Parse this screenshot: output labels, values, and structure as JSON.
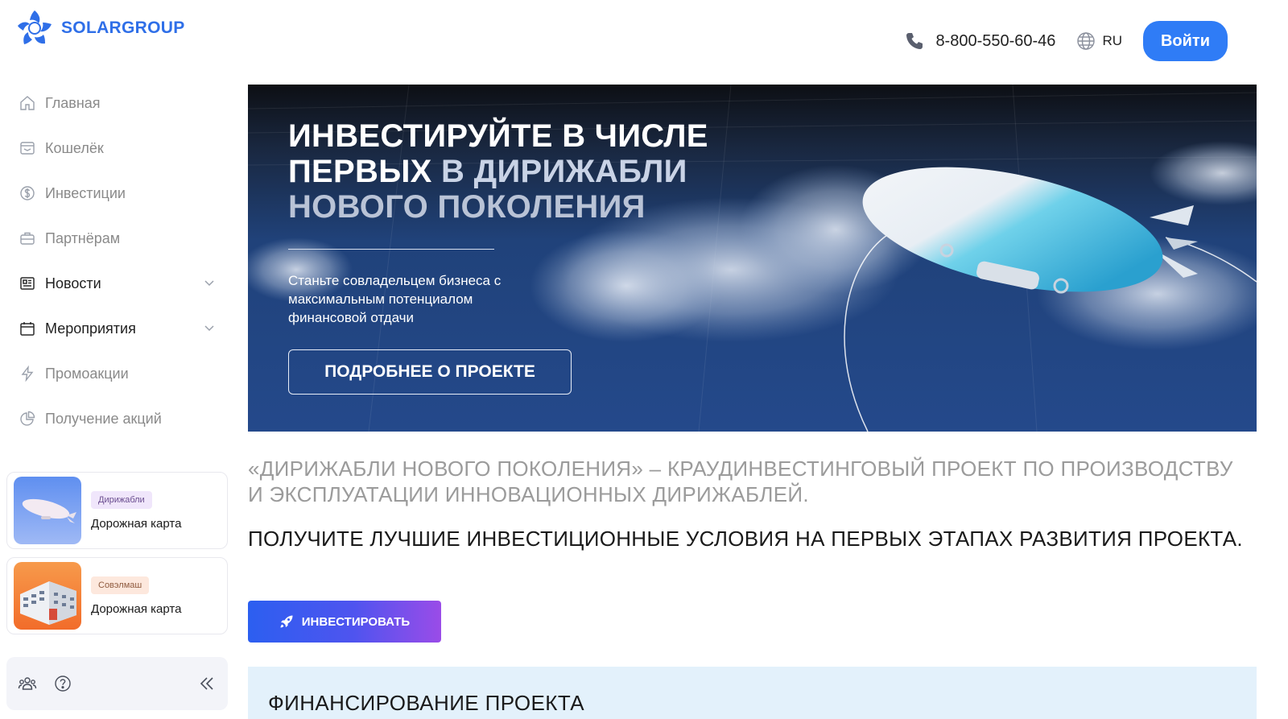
{
  "brand": {
    "name": "SOLARGROUP",
    "color": "#2f6fe8"
  },
  "header": {
    "phone": "8-800-550-60-46",
    "language": "RU",
    "login_label": "Войти",
    "accent": "#2f7cf6"
  },
  "sidebar": {
    "items": [
      {
        "label": "Главная",
        "icon": "home-icon"
      },
      {
        "label": "Кошелёк",
        "icon": "wallet-icon"
      },
      {
        "label": "Инвестиции",
        "icon": "dollar-coin-icon"
      },
      {
        "label": "Партнёрам",
        "icon": "briefcase-icon"
      },
      {
        "label": "Новости",
        "icon": "newspaper-icon"
      },
      {
        "label": "Мероприятия",
        "icon": "calendar-icon"
      },
      {
        "label": "Промоакции",
        "icon": "lightning-icon"
      },
      {
        "label": "Получение акций",
        "icon": "pie-chart-icon"
      }
    ],
    "cards": [
      {
        "tag": "Дирижабли",
        "title": "Дорожная карта"
      },
      {
        "tag": "Совэлмаш",
        "title": "Дорожная карта"
      }
    ]
  },
  "hero": {
    "title_line1": "ИНВЕСТИРУЙТЕ В ЧИСЛЕ",
    "title_line2a": "ПЕРВЫХ",
    "title_line2b": " В ДИРИЖАБЛИ",
    "title_line3": "НОВОГО ПОКОЛЕНИЯ",
    "subtitle": "Станьте совладельцем бизнеса с максимальным потенциалом финансовой отдачи",
    "button_label": "ПОДРОБНЕЕ О ПРОЕКТЕ"
  },
  "content": {
    "lead": "«ДИРИЖАБЛИ НОВОГО ПОКОЛЕНИЯ» – КРАУДИНВЕСТИНГОВЫЙ ПРОЕКТ ПО ПРОИЗВОДСТВУ И ЭКСПЛУАТАЦИИ ИННОВАЦИОННЫХ ДИРИЖАБЛЕЙ.",
    "subhead": "ПОЛУЧИТЕ ЛУЧШИЕ ИНВЕСТИЦИОННЫЕ УСЛОВИЯ НА ПЕРВЫХ ЭТАПАХ РАЗВИТИЯ ПРОЕКТА.",
    "invest_label": "ИНВЕСТИРОВАТЬ",
    "funding_title": "ФИНАНСИРОВАНИЕ ПРОЕКТА"
  }
}
